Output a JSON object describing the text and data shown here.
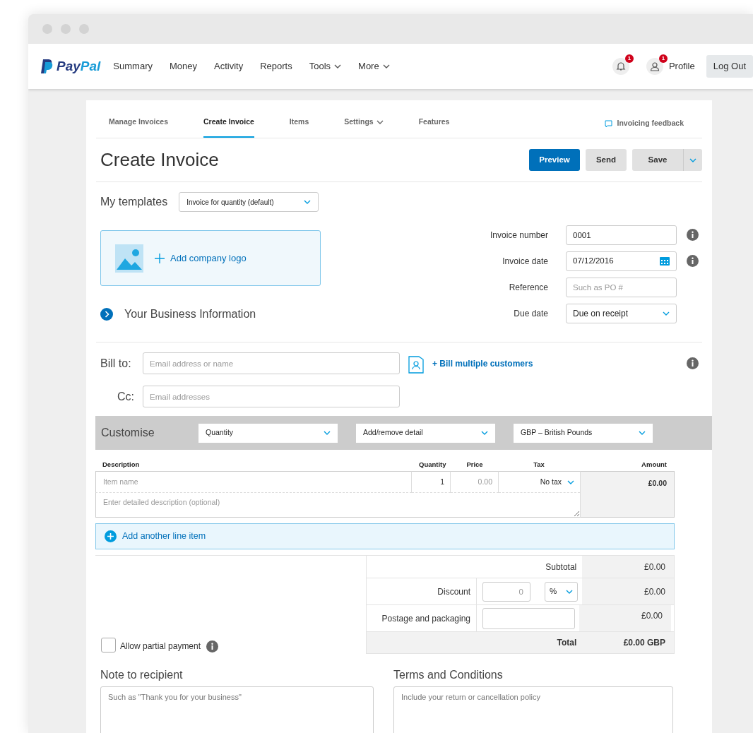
{
  "navbar": {
    "logo": "PayPal",
    "items": [
      {
        "label": "Summary",
        "dropdown": false
      },
      {
        "label": "Money",
        "dropdown": false
      },
      {
        "label": "Activity",
        "dropdown": false
      },
      {
        "label": "Reports",
        "dropdown": false
      },
      {
        "label": "Tools",
        "dropdown": true
      },
      {
        "label": "More",
        "dropdown": true
      }
    ],
    "notifications_badge": "1",
    "profile_badge": "1",
    "profile": "Profile",
    "logout": "Log Out"
  },
  "tabs": [
    {
      "label": "Manage Invoices",
      "selected": false,
      "dropdown": false
    },
    {
      "label": "Create Invoice",
      "selected": true,
      "dropdown": false
    },
    {
      "label": "Items",
      "selected": false,
      "dropdown": false
    },
    {
      "label": "Settings",
      "selected": false,
      "dropdown": true
    },
    {
      "label": "Features",
      "selected": false,
      "dropdown": false
    }
  ],
  "feedback": "Invoicing feedback",
  "title": "Create Invoice",
  "buttons": [
    {
      "label": "Preview",
      "kind": "primary"
    },
    {
      "label": "Send",
      "kind": "secondary"
    },
    {
      "label": "Save",
      "kind": "split"
    }
  ],
  "templates": {
    "label": "My templates",
    "value": "Invoice for quantity (default)"
  },
  "logo_upload": "Add company logo",
  "business_info": "Your Business Information",
  "invoice_fields": [
    {
      "label": "Invoice number",
      "kind": "text",
      "value": "0001",
      "info": true
    },
    {
      "label": "Invoice date",
      "kind": "date",
      "value": "07/12/2016",
      "info": true
    },
    {
      "label": "Reference",
      "kind": "text",
      "placeholder": "Such as PO #",
      "info": false
    },
    {
      "label": "Due date",
      "kind": "select",
      "value": "Due on receipt",
      "info": false
    }
  ],
  "bill_to": {
    "label": "Bill to:",
    "placeholder": "Email address or name",
    "multiple": "+ Bill multiple customers"
  },
  "cc": {
    "label": "Cc:",
    "placeholder": "Email addresses"
  },
  "customise": {
    "label": "Customise",
    "selects": [
      "Quantity",
      "Add/remove detail",
      "GBP – British Pounds"
    ]
  },
  "items_table": {
    "columns": [
      "Description",
      "Quantity",
      "Price",
      "Tax",
      "Amount"
    ],
    "rows": [
      {
        "name_placeholder": "Item name",
        "quantity": "1",
        "price_placeholder": "0.00",
        "tax": "No tax",
        "amount": "£0.00",
        "description_placeholder": "Enter detailed description (optional)"
      }
    ]
  },
  "add_line": "Add another line item",
  "totals": [
    {
      "kind": "plain",
      "label": "Subtotal",
      "amount": "£0.00"
    },
    {
      "kind": "discount",
      "label": "Discount",
      "placeholder": "0",
      "unit": "%",
      "amount": "£0.00"
    },
    {
      "kind": "input",
      "label": "Postage and packaging",
      "amount": "£0.00"
    },
    {
      "kind": "total",
      "label": "Total",
      "amount": "£0.00 GBP"
    }
  ],
  "partial_payment": {
    "label": "Allow partial payment",
    "checked": false
  },
  "note": {
    "label": "Note to recipient",
    "placeholder": "Such as \"Thank you for your business\""
  },
  "terms": {
    "label": "Terms and Conditions",
    "placeholder": "Include your return or cancellation policy"
  }
}
